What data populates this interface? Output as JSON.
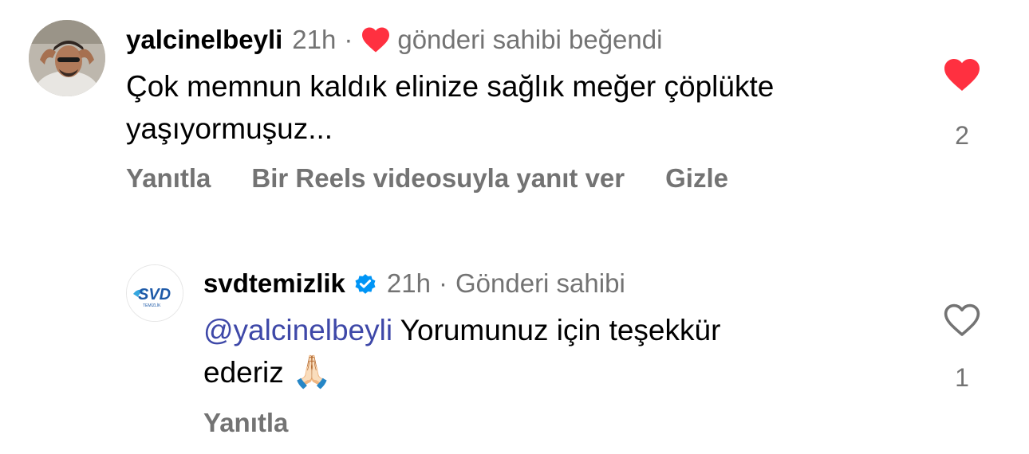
{
  "comments": [
    {
      "username": "yalcinelbeyli",
      "time": "21h",
      "owner_liked_text": "gönderi sahibi beğendi",
      "text_line1": "Çok memnun kaldık elinize sağlık meğer çöplükte",
      "text_line2": "yaşıyormuşuz...",
      "like_count": "2",
      "liked": true,
      "actions": {
        "reply": "Yanıtla",
        "reels_reply": "Bir Reels videosuyla yanıt ver",
        "hide": "Gizle"
      }
    },
    {
      "username": "svdtemizlik",
      "verified": true,
      "time": "21h",
      "owner_label": "Gönderi sahibi",
      "mention": "@yalcinelbeyli",
      "text_line1": " Yorumunuz için teşekkür",
      "text_line2": "ederiz",
      "emoji": "🙏🏻",
      "like_count": "1",
      "liked": false,
      "actions": {
        "reply": "Yanıtla"
      },
      "logo_text": "SVD",
      "logo_subtext": "TEMİZLİK"
    }
  ],
  "colors": {
    "like_red": "#ff3040",
    "muted_gray": "#737373",
    "mention_blue": "#3e48a8",
    "verified_blue": "#0095f6"
  }
}
